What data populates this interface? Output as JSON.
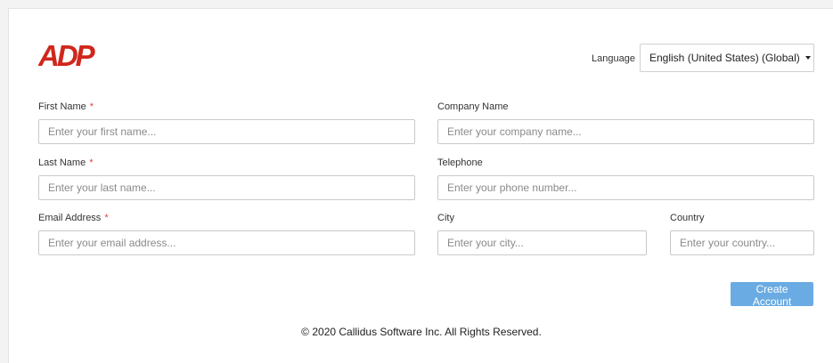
{
  "brand": {
    "logo_text": "ADP",
    "logo_color": "#d0271d"
  },
  "language": {
    "label": "Language",
    "selected": "English (United States) (Global)"
  },
  "form": {
    "first_name": {
      "label": "First Name",
      "required_mark": "*",
      "placeholder": "Enter your first name..."
    },
    "last_name": {
      "label": "Last Name",
      "required_mark": "*",
      "placeholder": "Enter your last name..."
    },
    "email": {
      "label": "Email Address",
      "required_mark": "*",
      "placeholder": "Enter your email address..."
    },
    "company": {
      "label": "Company Name",
      "placeholder": "Enter your company name..."
    },
    "telephone": {
      "label": "Telephone",
      "placeholder": "Enter your phone number..."
    },
    "city": {
      "label": "City",
      "placeholder": "Enter your city..."
    },
    "country": {
      "label": "Country",
      "placeholder": "Enter your country..."
    },
    "submit_label": "Create Account"
  },
  "colors": {
    "accent_button": "#6aabe3",
    "required": "#e04040"
  },
  "footer": {
    "copyright": "© 2020 Callidus Software Inc. All Rights Reserved."
  }
}
